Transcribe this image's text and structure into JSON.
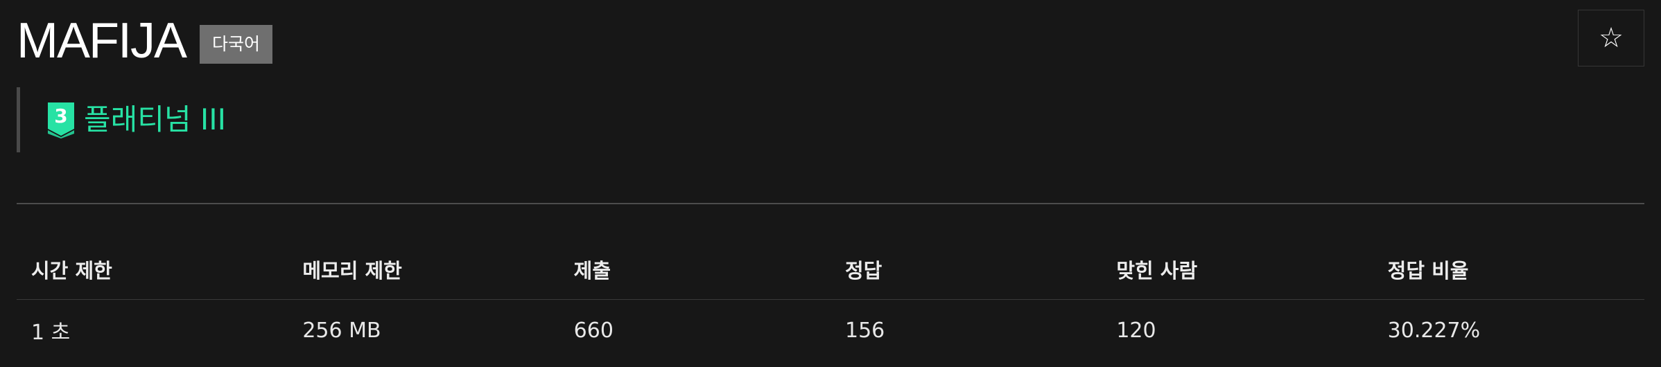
{
  "problem": {
    "title": "MAFIJA",
    "language_badge": "다국어",
    "favorite_icon": "star-outline-icon",
    "tier": {
      "label": "플래티넘 III",
      "level": "3",
      "icon": "platinum-tier-shield-icon",
      "color": "#27e2a4"
    }
  },
  "stats": {
    "headers": [
      "시간 제한",
      "메모리 제한",
      "제출",
      "정답",
      "맞힌 사람",
      "정답 비율"
    ],
    "values": [
      "1 초",
      "256 MB",
      "660",
      "156",
      "120",
      "30.227%"
    ]
  }
}
